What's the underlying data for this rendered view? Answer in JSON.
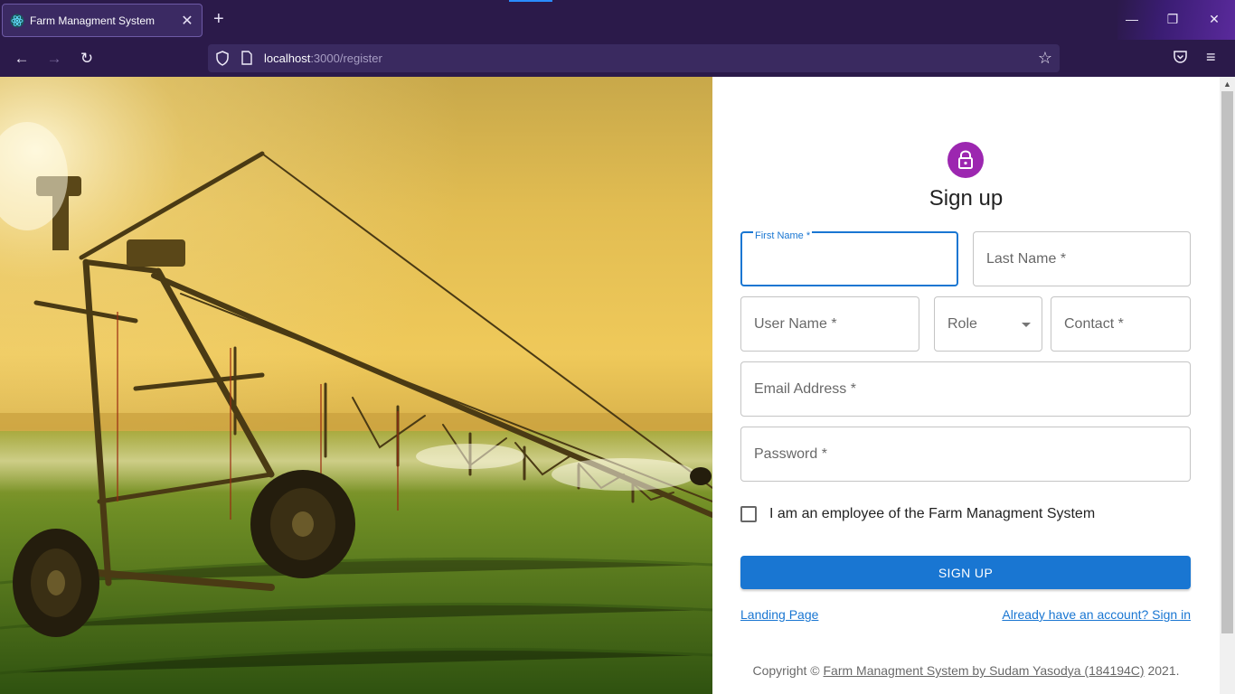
{
  "browser": {
    "tab_title": "Farm Managment System",
    "tab_close": "✕",
    "new_tab": "+",
    "url_host": "localhost",
    "url_path": ":3000/register",
    "window_controls": {
      "minimize": "—",
      "restore": "❐",
      "close": "✕"
    },
    "nav": {
      "back": "←",
      "forward": "→",
      "reload": "↻",
      "star": "☆",
      "menu": "≡"
    },
    "colors": {
      "chrome": "#2b1a4a",
      "urlbar": "#3a2a60",
      "accent": "#2a8cff"
    }
  },
  "hero": {
    "image_subject": "center-pivot-irrigation-at-sunset"
  },
  "form": {
    "title": "Sign up",
    "avatar_icon": "lock-icon",
    "avatar_color": "#9c27b0",
    "fields": {
      "first_name_label": "First Name *",
      "last_name": "Last Name *",
      "user_name": "User Name *",
      "role": "Role",
      "contact": "Contact *",
      "email": "Email Address *",
      "password": "Password *"
    },
    "checkbox_label": "I am an employee of the Farm Managment System",
    "submit": "SIGN UP",
    "submit_color": "#1976d2",
    "link_landing": "Landing Page",
    "link_signin": "Already have an account? Sign in"
  },
  "footer": {
    "prefix": "Copyright © ",
    "link": "Farm Managment System by Sudam Yasodya (184194C)",
    "suffix": " 2021."
  }
}
